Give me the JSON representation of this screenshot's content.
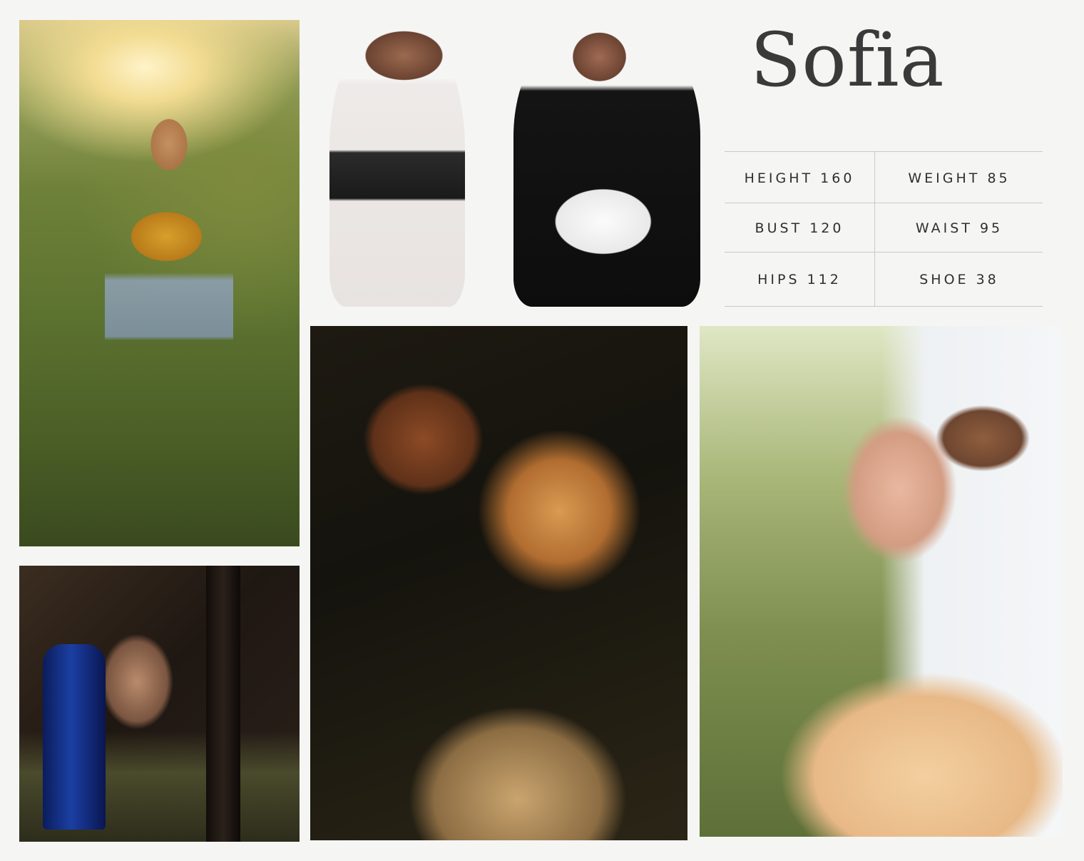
{
  "name": "Sofia",
  "measurements": [
    {
      "label": "HEIGHT",
      "value": "160"
    },
    {
      "label": "WEIGHT",
      "value": "85"
    },
    {
      "label": "BUST",
      "value": "120"
    },
    {
      "label": "WAIST",
      "value": "95"
    },
    {
      "label": "HIPS",
      "value": "112"
    },
    {
      "label": "SHOE",
      "value": "38"
    }
  ]
}
